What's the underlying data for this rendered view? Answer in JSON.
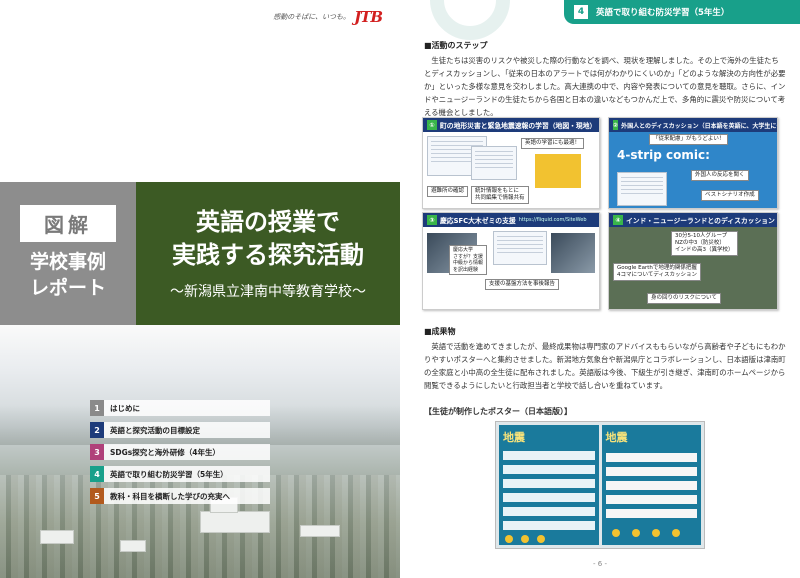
{
  "left_page": {
    "brand": {
      "slogan": "感動のそばに、いつも。",
      "logo": "JTB"
    },
    "badge": {
      "zukai": "図解",
      "report": "学校事例\nレポート"
    },
    "title": {
      "main": "英語の授業で\n実践する探究活動",
      "sub": "〜新潟県立津南中等教育学校〜"
    },
    "toc": [
      {
        "num": "1",
        "label": "はじめに",
        "color": "#8a8a8a"
      },
      {
        "num": "2",
        "label": "英語と探究活動の目標設定",
        "color": "#1d3b7a"
      },
      {
        "num": "3",
        "label": "SDGs探究と海外研修（4年生）",
        "color": "#b0417a"
      },
      {
        "num": "4",
        "label": "英語で取り組む防災学習（5年生）",
        "color": "#18a08a"
      },
      {
        "num": "5",
        "label": "教科・科目を横断した学びの充実へ",
        "color": "#b25a1e"
      }
    ]
  },
  "right_page": {
    "chapter": {
      "num": "4",
      "label": "英語で取り組む防災学習（5年生）",
      "color": "#18a08a"
    },
    "section1": {
      "heading": "■活動のステップ",
      "text": "生徒たちは災害のリスクや被災した際の行動などを調べ、現状を理解しました。その上で海外の生徒たちとディスカッションし、「従来の日本のアラートでは何がわかりにくいのか」「どのような解決の方向性が必要か」といった多様な意見を交わしました。高大連携の中で、内容や発表についての意見を聴取。さらに、インドやニュージーランドの生徒たちから各国と日本の違いなどもつかんだ上で、多角的に震災や防災について考える機会としました。"
    },
    "panels": [
      {
        "num": "①",
        "title": "町の地形災害と緊急地震速報の学習（地図・現地）",
        "tags": [
          "英語の学習にも最適！",
          "避難所の確認",
          "統計情報をもとに\n共同編集で情報共有"
        ]
      },
      {
        "num": "②",
        "title": "外国人とのディスカッション（日本語を英語に、大学生にも）",
        "tags": [
          "「従来配慮」がもうどよい！",
          "4-strip comic:",
          "外国人の反応を聞く",
          "ベストシナリオ作成"
        ]
      },
      {
        "num": "③",
        "title": "慶応SFC大木ゼミの支援",
        "url": "https://fliquid.com/SiteWeb",
        "tags": [
          "慶応大学\nさすが？支援\n中級から情報\nを訳出経験",
          "支援の基盤方法を事後報告"
        ]
      },
      {
        "num": "④",
        "title": "インド・ニュージーランドとのディスカッション",
        "tags": [
          "30分5-10人グループ\nNZの中3（防災校）\nインドの高3（異学校）",
          "Google Earthで地理的関係把握\n4コマについてディスカッション",
          "身の回りのリスクについて"
        ]
      }
    ],
    "section2": {
      "heading": "■成果物",
      "text": "英語で活動を進めてきましたが、最終成果物は専門家のアドバイスももらいながら高齢者や子どもにもわかりやすいポスターへと集約させました。新潟地方気象台や新潟県庁とコラボレーションし、日本語版は津南町の全家庭と小中高の全生徒に配布されました。英語版は今後、下級生が引き継ぎ、津南町のホームページから閲覧できるようにしたいと行政担当者と学校で話し合いを重ねています。"
    },
    "poster": {
      "caption": "【生徒が制作したポスター（日本語版）】",
      "left_title": "地震",
      "right_title": "地震"
    },
    "page_number": "- 6 -"
  }
}
